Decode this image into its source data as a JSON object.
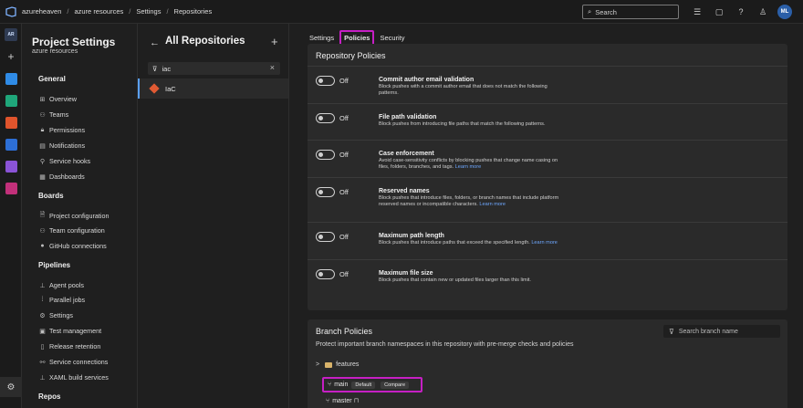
{
  "header": {
    "breadcrumbs": [
      "azureheaven",
      "azure resources",
      "Settings",
      "Repositories"
    ],
    "search_placeholder": "Search",
    "avatar_initials": "ML"
  },
  "rail": {
    "project_initials": "AR"
  },
  "nav": {
    "title": "Project Settings",
    "subtitle": "azure resources",
    "sections": [
      {
        "title": "General",
        "items": [
          "Overview",
          "Teams",
          "Permissions",
          "Notifications",
          "Service hooks",
          "Dashboards"
        ]
      },
      {
        "title": "Boards",
        "items": [
          "Project configuration",
          "Team configuration",
          "GitHub connections"
        ]
      },
      {
        "title": "Pipelines",
        "items": [
          "Agent pools",
          "Parallel jobs",
          "Settings",
          "Test management",
          "Release retention",
          "Service connections",
          "XAML build services"
        ]
      },
      {
        "title": "Repos",
        "items": []
      }
    ]
  },
  "repos": {
    "title": "All Repositories",
    "filter_value": "iac",
    "items": [
      "IaC"
    ]
  },
  "tabs": [
    "Settings",
    "Policies",
    "Security"
  ],
  "repository_policies": {
    "title": "Repository Policies",
    "items": [
      {
        "state": "Off",
        "title": "Commit author email validation",
        "desc": "Block pushes with a commit author email that does not match the following patterns.",
        "link": ""
      },
      {
        "state": "Off",
        "title": "File path validation",
        "desc": "Block pushes from introducing file paths that match the following patterns.",
        "link": ""
      },
      {
        "state": "Off",
        "title": "Case enforcement",
        "desc": "Avoid case-sensitivity conflicts by blocking pushes that change name casing on files, folders, branches, and tags.",
        "link": "Learn more"
      },
      {
        "state": "Off",
        "title": "Reserved names",
        "desc": "Block pushes that introduce files, folders, or branch names that include platform reserved names or incompatible characters.",
        "link": "Learn more"
      },
      {
        "state": "Off",
        "title": "Maximum path length",
        "desc": "Block pushes that introduce paths that exceed the specified length.",
        "link": "Learn more"
      },
      {
        "state": "Off",
        "title": "Maximum file size",
        "desc": "Block pushes that contain new or updated files larger than this limit.",
        "link": ""
      }
    ]
  },
  "branch_policies": {
    "title": "Branch Policies",
    "subtitle": "Protect important branch namespaces in this repository with pre-merge checks and policies",
    "search_placeholder": "Search branch name",
    "folder": "features",
    "main_branch": "main",
    "default_badge": "Default",
    "compare_badge": "Compare",
    "master_branch": "master"
  }
}
